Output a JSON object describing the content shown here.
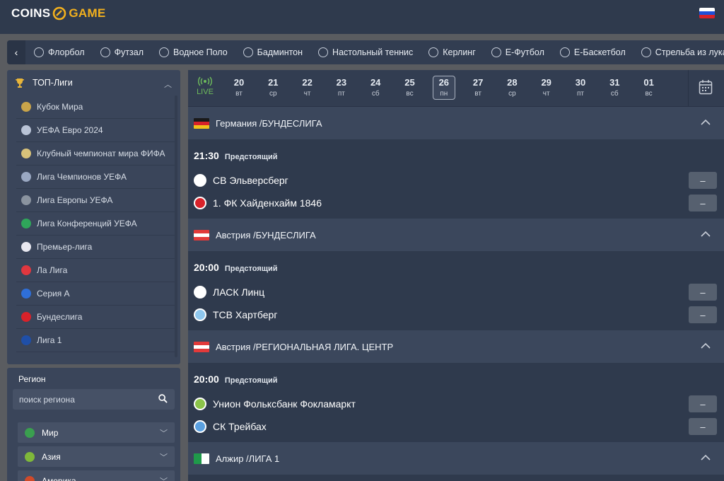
{
  "brand": {
    "coins": "COINS",
    "game": "GAME"
  },
  "sports_nav": [
    {
      "label": "Флорбол",
      "icon": "floorball-icon"
    },
    {
      "label": "Футзал",
      "icon": "futsal-icon"
    },
    {
      "label": "Водное Поло",
      "icon": "water-polo-icon"
    },
    {
      "label": "Бадминтон",
      "icon": "badminton-icon"
    },
    {
      "label": "Настольный теннис",
      "icon": "table-tennis-icon"
    },
    {
      "label": "Керлинг",
      "icon": "curling-icon"
    },
    {
      "label": "Е-Футбол",
      "icon": "efootball-icon"
    },
    {
      "label": "Е-Баскетбол",
      "icon": "ebasketball-icon"
    },
    {
      "label": "Стрельба из лука",
      "icon": "archery-icon"
    }
  ],
  "top_leagues": {
    "title": "ТОП-Лиги",
    "items": [
      {
        "label": "Кубок Мира",
        "color": "#c9a44a"
      },
      {
        "label": "УЕФА Евро 2024",
        "color": "#b9c3d6"
      },
      {
        "label": "Клубный чемпионат мира ФИФА",
        "color": "#d8c27a"
      },
      {
        "label": "Лига Чемпионов УЕФА",
        "color": "#9aa8c2"
      },
      {
        "label": "Лига Европы УЕФА",
        "color": "#8a939f"
      },
      {
        "label": "Лига Конференций УЕФА",
        "color": "#2fa65a"
      },
      {
        "label": "Премьер-лига",
        "color": "#e8e8f0"
      },
      {
        "label": "Ла Лига",
        "color": "#e0373f"
      },
      {
        "label": "Серия А",
        "color": "#2f6fd8"
      },
      {
        "label": "Бундеслига",
        "color": "#d8222a"
      },
      {
        "label": "Лига 1",
        "color": "#1f4fa8"
      }
    ]
  },
  "region": {
    "title": "Регион",
    "search_placeholder": "поиск региона",
    "items": [
      {
        "label": "Мир",
        "color": "#3a9f4f"
      },
      {
        "label": "Азия",
        "color": "#7fb83a"
      },
      {
        "label": "Америка",
        "color": "#d04a2a"
      }
    ]
  },
  "date_bar": {
    "live": "LIVE",
    "dates": [
      {
        "day": "20",
        "wd": "вт"
      },
      {
        "day": "21",
        "wd": "ср"
      },
      {
        "day": "22",
        "wd": "чт"
      },
      {
        "day": "23",
        "wd": "пт"
      },
      {
        "day": "24",
        "wd": "сб"
      },
      {
        "day": "25",
        "wd": "вс"
      },
      {
        "day": "26",
        "wd": "пн",
        "active": true
      },
      {
        "day": "27",
        "wd": "вт"
      },
      {
        "day": "28",
        "wd": "ср"
      },
      {
        "day": "29",
        "wd": "чт"
      },
      {
        "day": "30",
        "wd": "пт"
      },
      {
        "day": "31",
        "wd": "сб"
      },
      {
        "day": "01",
        "wd": "вс"
      }
    ]
  },
  "groups": [
    {
      "title": "Германия /БУНДЕСЛИГА",
      "flag": [
        "#1a1a1a",
        "#d8222a",
        "#f2c21a"
      ],
      "time": "21:30",
      "status": "Предстоящий",
      "teams": [
        {
          "name": "СВ Эльверсберг",
          "odd": "–",
          "crest": "#ffffff"
        },
        {
          "name": "1. ФК Хайденхайм 1846",
          "odd": "–",
          "crest": "#d8222a"
        }
      ]
    },
    {
      "title": "Австрия /БУНДЕСЛИГА",
      "flag": [
        "#e23a3a",
        "#ffffff",
        "#e23a3a"
      ],
      "time": "20:00",
      "status": "Предстоящий",
      "teams": [
        {
          "name": "ЛАСК Линц",
          "odd": "–",
          "crest": "#ffffff"
        },
        {
          "name": "ТСВ Хартберг",
          "odd": "–",
          "crest": "#8ec7ee"
        }
      ]
    },
    {
      "title": "Австрия /РЕГИОНАЛЬНАЯ ЛИГА. ЦЕНТР",
      "flag": [
        "#e23a3a",
        "#ffffff",
        "#e23a3a"
      ],
      "time": "20:00",
      "status": "Предстоящий",
      "teams": [
        {
          "name": "Унион Фольксбанк Фокламаркт",
          "odd": "–",
          "crest": "#8bc34a"
        },
        {
          "name": "СК Трейбах",
          "odd": "–",
          "crest": "#5aa0e0"
        }
      ]
    },
    {
      "title": "Алжир /ЛИГА 1",
      "flag": [
        "#1f9a4a",
        "#ffffff"
      ],
      "time": "",
      "status": "",
      "teams": []
    }
  ]
}
